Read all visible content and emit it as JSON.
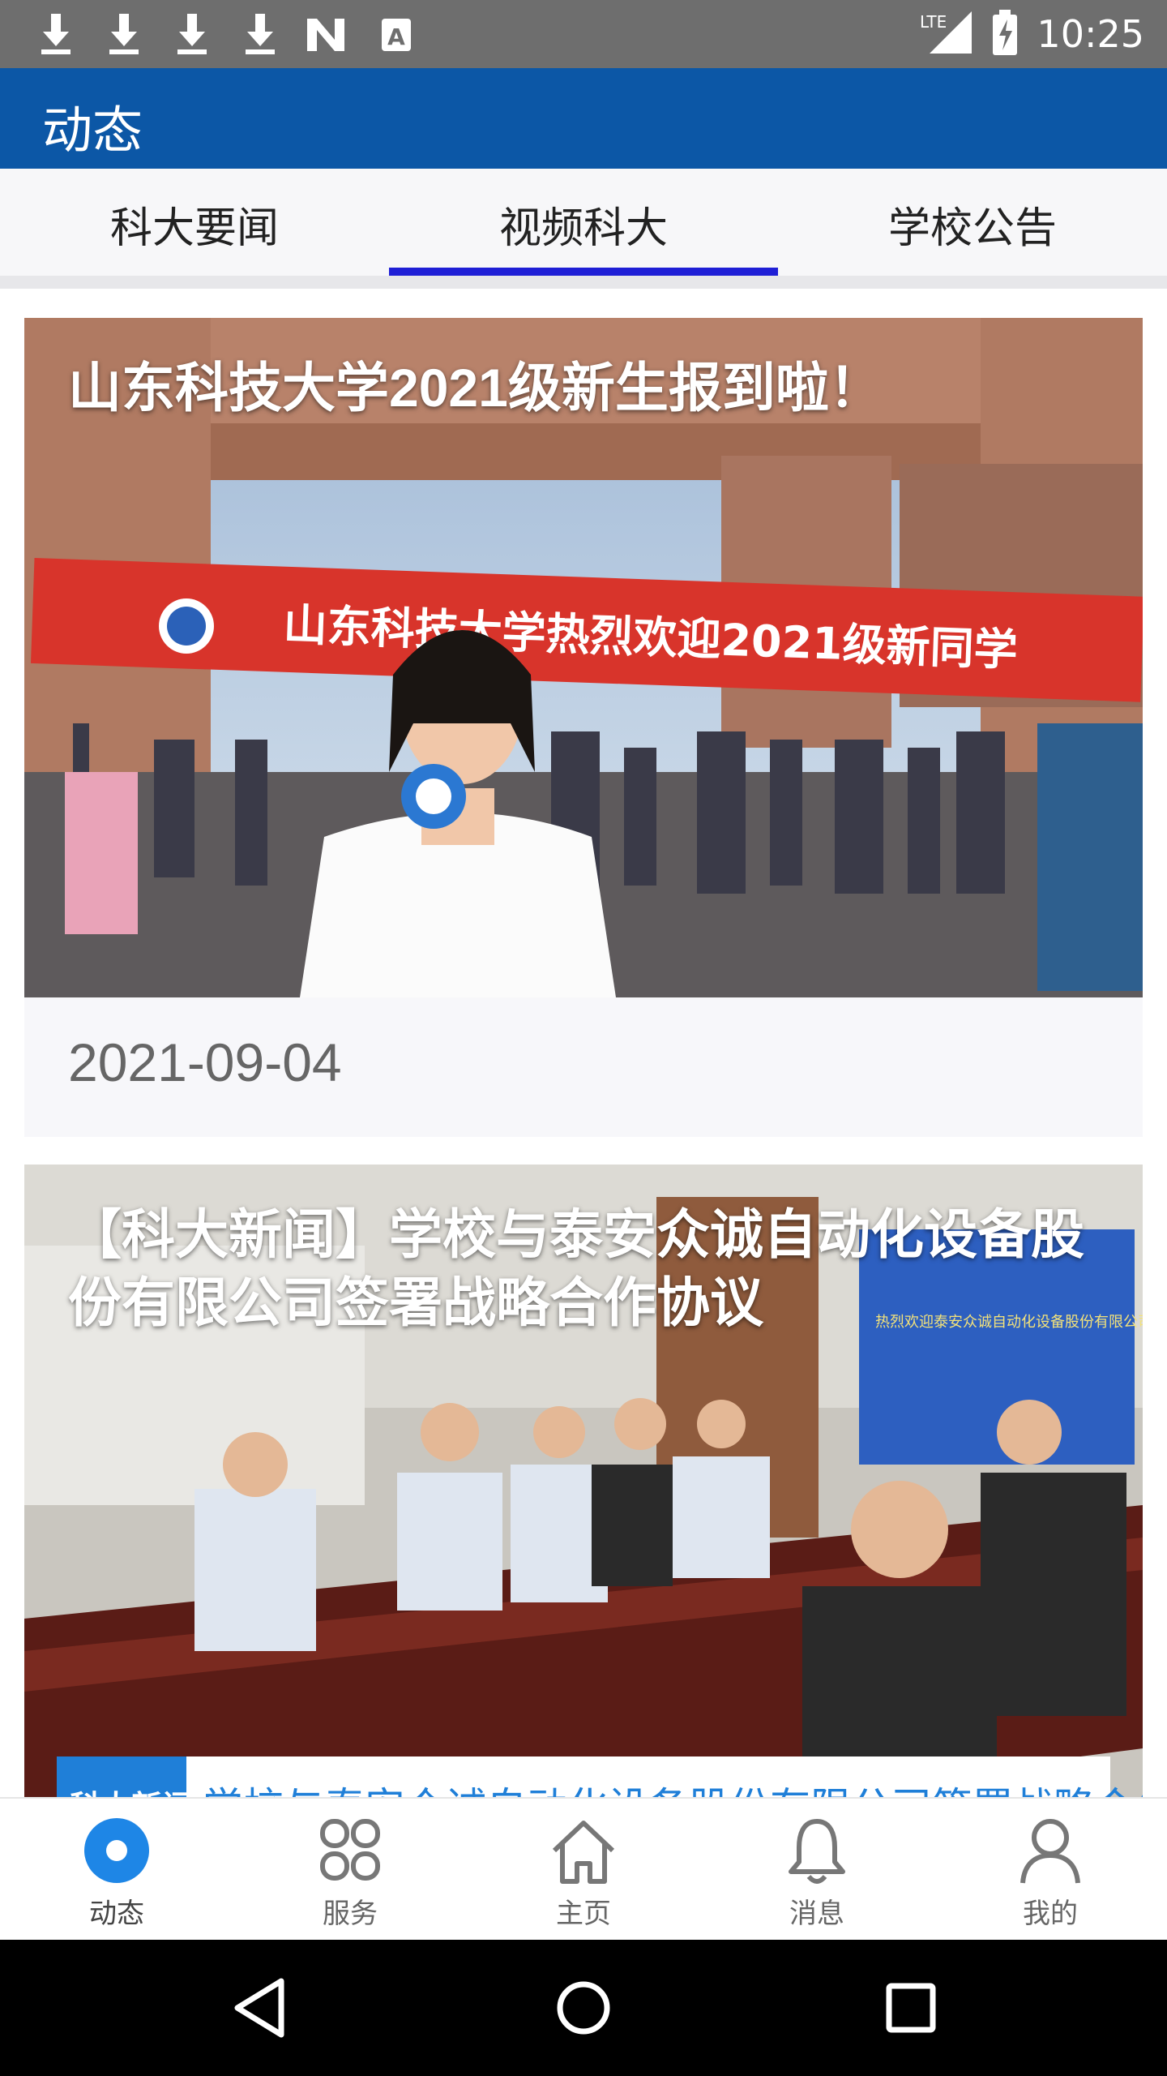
{
  "status_bar": {
    "time": "10:25",
    "network": "LTE",
    "left_icons": [
      "download-icon",
      "download-icon",
      "download-icon",
      "download-icon",
      "n-logo-icon",
      "a-icon"
    ]
  },
  "app_bar": {
    "title": "动态"
  },
  "tabs": [
    {
      "label": "科大要闻",
      "active": false
    },
    {
      "label": "视频科大",
      "active": true
    },
    {
      "label": "学校公告",
      "active": false
    }
  ],
  "feed": {
    "items": [
      {
        "title": "山东科技大学2021级新生报到啦！",
        "date": "2021-09-04",
        "banner_text": "山东科技大学热烈欢迎2021级新同学"
      },
      {
        "title": "【科大新闻】学校与泰安众诚自动化设备股份有限公司签署战略合作协议",
        "date": "",
        "screen_text": "热烈欢迎泰安众诚自动化设备股份有限公司领导莅临学校",
        "caption_tag": "科大新闻",
        "caption_text": "学校与泰安众诚自动化设备股份有限公司签署战略合作协议"
      }
    ]
  },
  "bottom_nav": [
    {
      "label": "动态",
      "icon": "dynamic-icon",
      "active": true
    },
    {
      "label": "服务",
      "icon": "services-icon",
      "active": false
    },
    {
      "label": "主页",
      "icon": "home-icon",
      "active": false
    },
    {
      "label": "消息",
      "icon": "bell-icon",
      "active": false
    },
    {
      "label": "我的",
      "icon": "profile-icon",
      "active": false
    }
  ],
  "colors": {
    "primary": "#0c57a6",
    "tab_indicator": "#1f1fd6",
    "active_nav": "#1e86e6"
  }
}
